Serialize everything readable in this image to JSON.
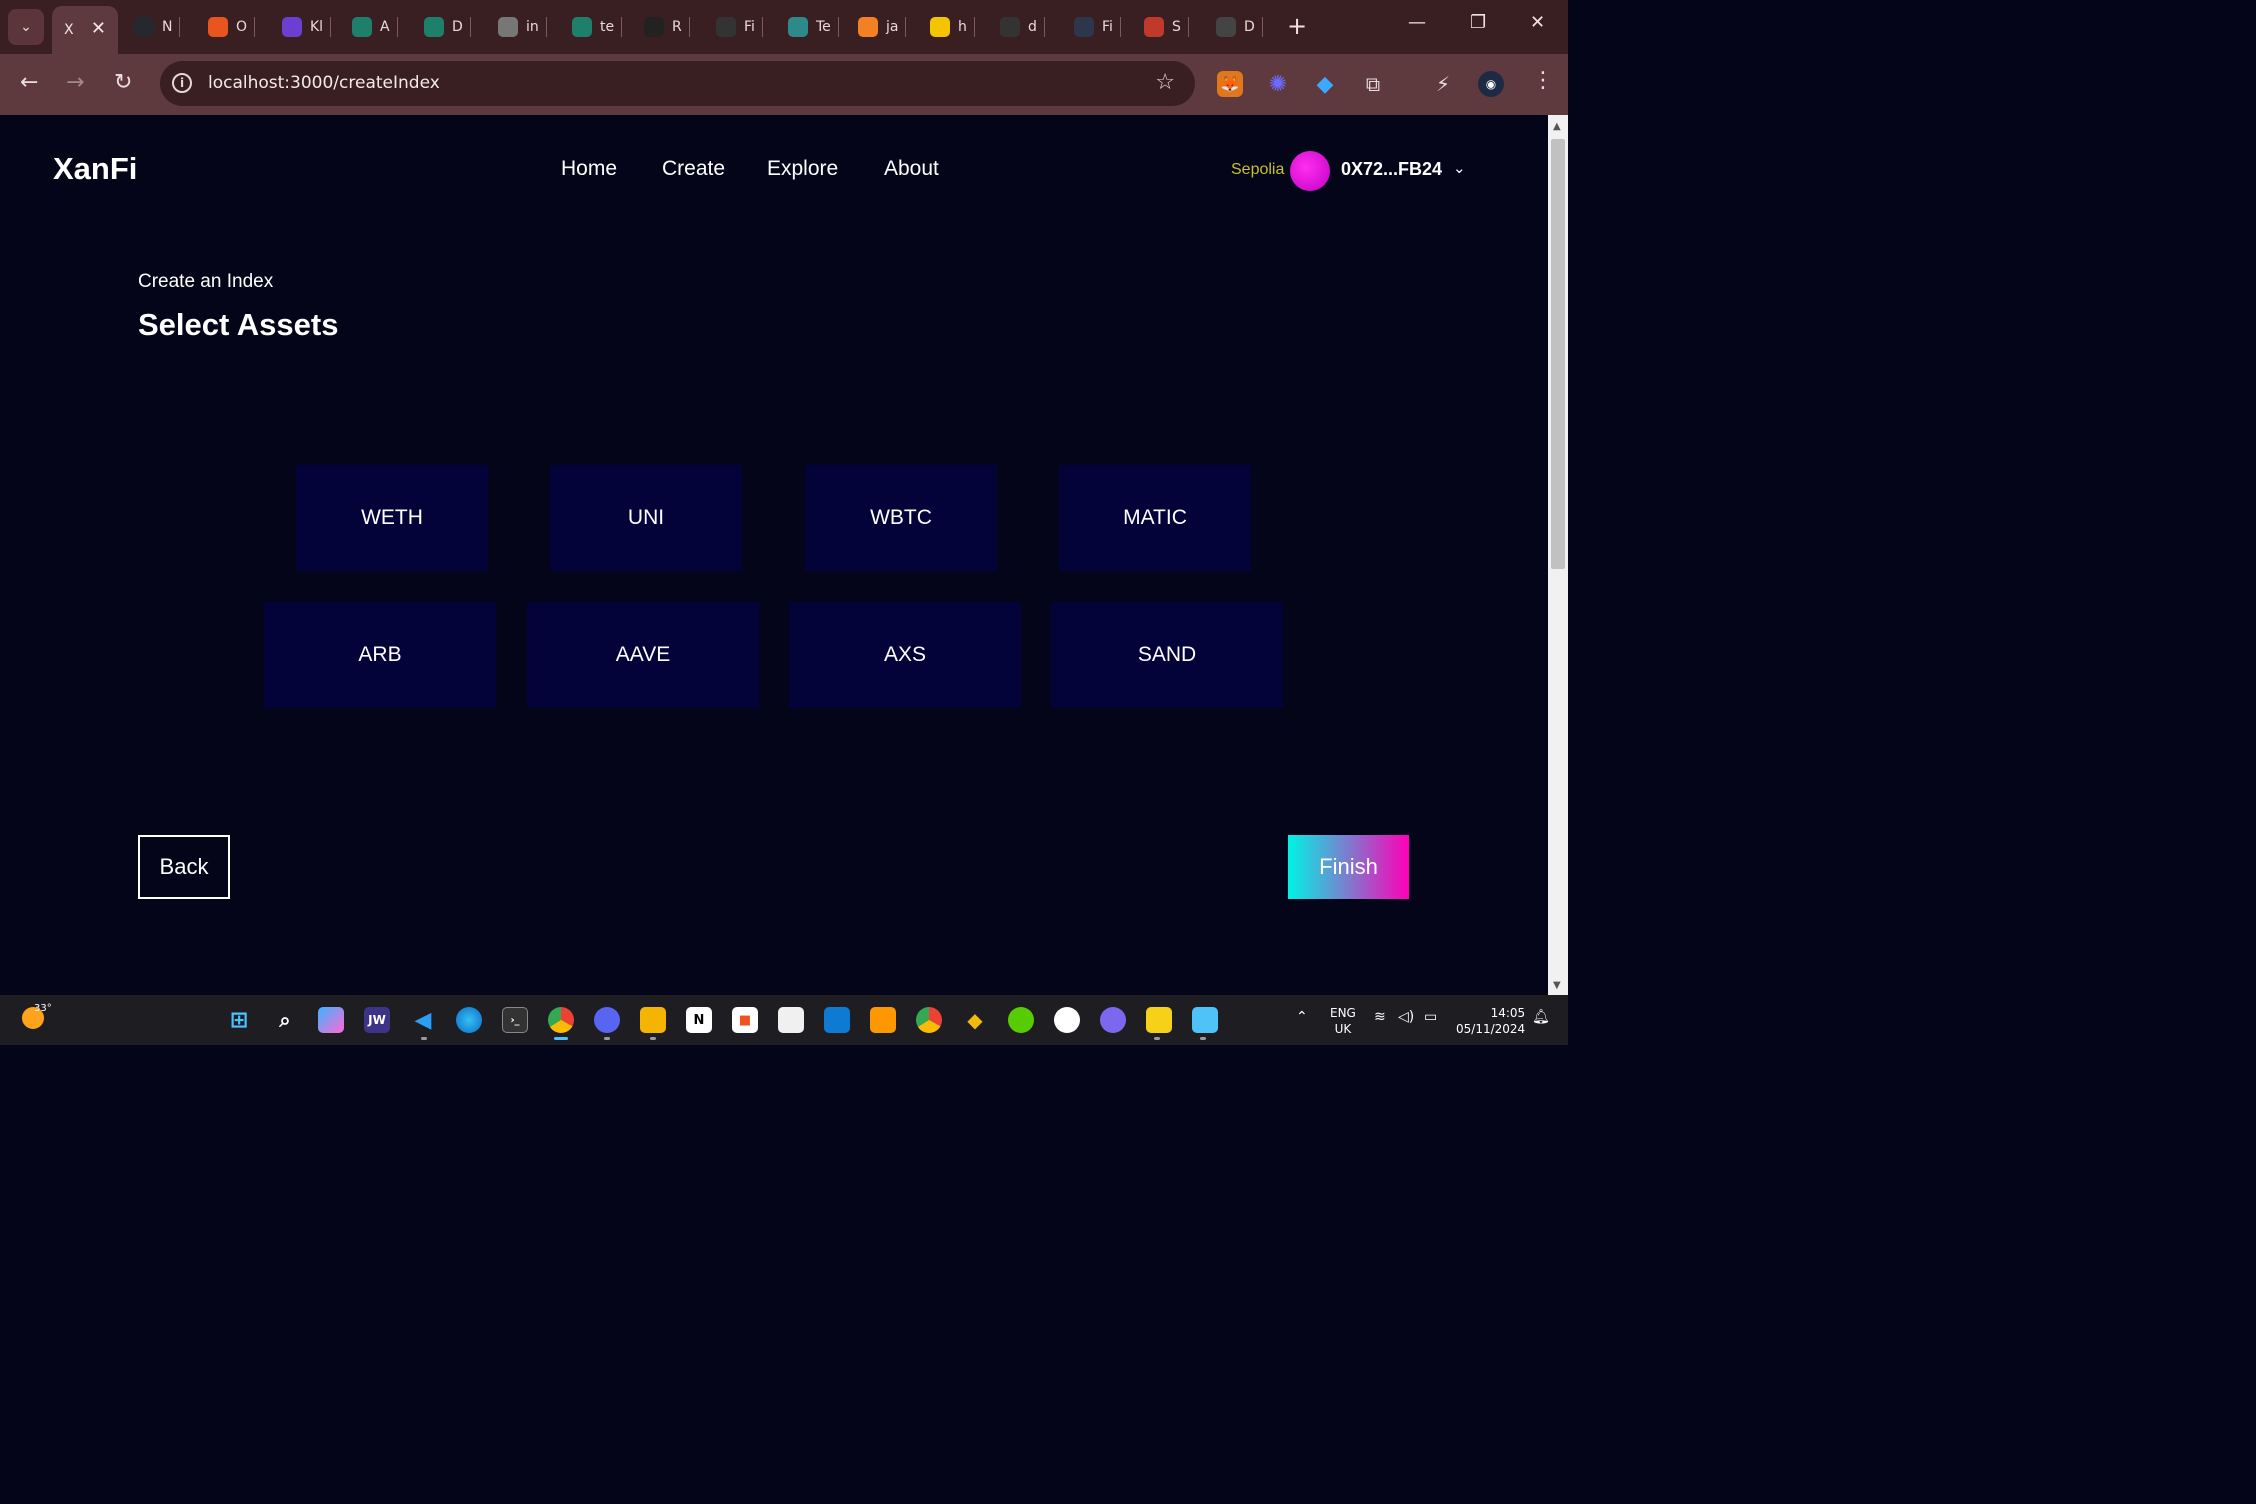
{
  "browser": {
    "active_tab_label": "X",
    "tabs": [
      {
        "label": "N",
        "icon": "github-icon",
        "color": "#24292f"
      },
      {
        "label": "O",
        "icon": "flame-icon",
        "color": "#e8551f"
      },
      {
        "label": "Kl",
        "icon": "kleros-icon",
        "color": "#6c3fd1"
      },
      {
        "label": "A",
        "icon": "xanfi-icon",
        "color": "#1e7f6b"
      },
      {
        "label": "D",
        "icon": "xanfi-icon",
        "color": "#1e7f6b"
      },
      {
        "label": "in",
        "icon": "binary-icon",
        "color": "#777777"
      },
      {
        "label": "te",
        "icon": "xanfi-icon",
        "color": "#1e7f6b"
      },
      {
        "label": "R",
        "icon": "openai-icon",
        "color": "#222222"
      },
      {
        "label": "Fi",
        "icon": "chart-icon",
        "color": "#333333"
      },
      {
        "label": "Te",
        "icon": "refresh-icon",
        "color": "#2e8a8a"
      },
      {
        "label": "ja",
        "icon": "stackoverflow-icon",
        "color": "#f48024"
      },
      {
        "label": "h",
        "icon": "warning-icon",
        "color": "#f4c400"
      },
      {
        "label": "d",
        "icon": "cloud-icon",
        "color": "#333333"
      },
      {
        "label": "Fi",
        "icon": "arbitrum-icon",
        "color": "#2d374b"
      },
      {
        "label": "S",
        "icon": "shield-icon",
        "color": "#c0392b"
      },
      {
        "label": "D",
        "icon": "download-icon",
        "color": "#444444"
      }
    ],
    "new_tab_symbol": "+",
    "url": "localhost:3000/createIndex",
    "info_symbol": "i",
    "star_symbol": "☆",
    "menu_symbol": "⋮"
  },
  "header": {
    "brand": "XanFi",
    "nav": [
      "Home",
      "Create",
      "Explore",
      "About"
    ],
    "network": "Sepolia",
    "wallet_address": "0X72...FB24",
    "chevron_symbol": "⌄"
  },
  "main": {
    "subtitle": "Create an Index",
    "title": "Select Assets",
    "assets_row1": [
      "WETH",
      "UNI",
      "WBTC",
      "MATIC"
    ],
    "assets_row2": [
      "ARB",
      "AAVE",
      "AXS",
      "SAND"
    ],
    "back_label": "Back",
    "finish_label": "Finish"
  },
  "colors": {
    "page_bg": "#05051a",
    "asset_bg": "#03033a",
    "network_text": "#c9c02a",
    "finish_gradient_start": "#00f3e4",
    "finish_gradient_end": "#ff00b8"
  },
  "taskbar": {
    "temperature": "33°",
    "language": "ENG",
    "region": "UK",
    "time": "14:05",
    "date": "05/11/2024",
    "apps": [
      "windows-start-icon",
      "search-icon",
      "copilot-icon",
      "jw-icon",
      "vscode-icon",
      "edge-icon",
      "terminal-icon",
      "chrome-icon",
      "discord-icon",
      "file-explorer-icon",
      "notion-icon",
      "store-icon",
      "notepad-icon",
      "remote-desktop-icon",
      "sublime-icon",
      "chrome-profile-icon",
      "binance-icon",
      "duolingo-icon",
      "github-icon",
      "settings-icon",
      "sticky-notes-icon",
      "notepad-blue-icon"
    ],
    "jw_label": "JW",
    "notion_label": "N"
  }
}
